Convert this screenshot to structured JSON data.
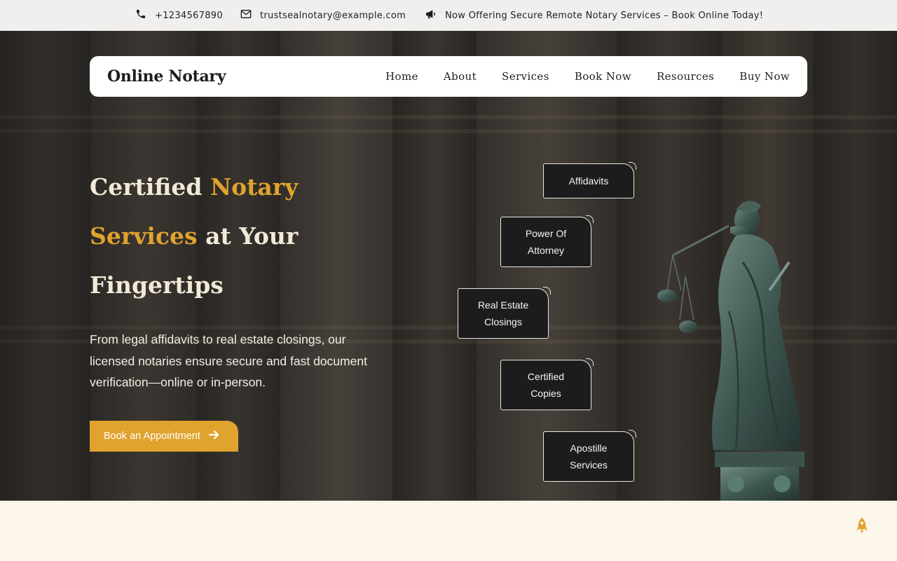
{
  "topbar": {
    "phone": "+1234567890",
    "email": "trustsealnotary@example.com",
    "announcement": "Now Offering Secure Remote Notary Services – Book Online Today!",
    "icons": [
      "phone-icon",
      "mail-icon",
      "megaphone-icon"
    ]
  },
  "navbar": {
    "logo": "Online Notary",
    "items": [
      {
        "label": "Home"
      },
      {
        "label": "About"
      },
      {
        "label": "Services"
      },
      {
        "label": "Book Now"
      },
      {
        "label": "Resources"
      },
      {
        "label": "Buy Now"
      }
    ]
  },
  "hero": {
    "headline": {
      "part1": "Certified ",
      "accent1": "Notary",
      "accent2": "Services",
      "part2": " at Your",
      "part3": "Fingertips"
    },
    "subtext": "From legal affidavits to real estate closings, our licensed notaries ensure secure and fast document verification—online or in-person.",
    "cta_label": "Book an Appointment",
    "services": [
      {
        "line1": "Affidavits",
        "line2": ""
      },
      {
        "line1": "Power Of",
        "line2": "Attorney"
      },
      {
        "line1": "Real Estate",
        "line2": "Closings"
      },
      {
        "line1": "Certified",
        "line2": "Copies"
      },
      {
        "line1": "Apostille",
        "line2": "Services"
      }
    ]
  },
  "colors": {
    "accent": "#e0a32e",
    "topbar_bg": "#f0efed",
    "section_bg": "#fdf6ea",
    "service_box_bg": "#1c1c1c"
  }
}
